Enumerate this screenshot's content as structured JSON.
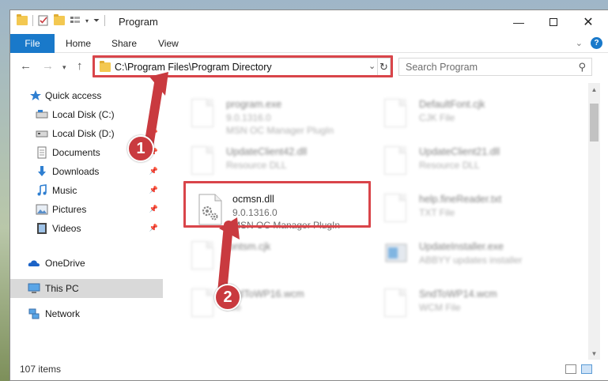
{
  "window": {
    "title": "Program"
  },
  "ribbon": {
    "tabs": [
      {
        "label": "File"
      },
      {
        "label": "Home"
      },
      {
        "label": "Share"
      },
      {
        "label": "View"
      }
    ]
  },
  "address": {
    "path": "C:\\Program Files\\Program Directory"
  },
  "search": {
    "placeholder": "Search Program"
  },
  "sidebar": {
    "items": [
      {
        "label": "Quick access",
        "icon": "star-icon"
      },
      {
        "label": "Local Disk (C:)",
        "icon": "drive-icon"
      },
      {
        "label": "Local Disk (D:)",
        "icon": "drive-icon"
      },
      {
        "label": "Documents",
        "icon": "documents-icon"
      },
      {
        "label": "Downloads",
        "icon": "download-icon"
      },
      {
        "label": "Music",
        "icon": "music-icon"
      },
      {
        "label": "Pictures",
        "icon": "pictures-icon"
      },
      {
        "label": "Videos",
        "icon": "videos-icon"
      },
      {
        "label": "OneDrive",
        "icon": "cloud-icon"
      },
      {
        "label": "This PC",
        "icon": "computer-icon"
      },
      {
        "label": "Network",
        "icon": "network-icon"
      }
    ]
  },
  "files": [
    {
      "name": "program.exe",
      "line2": "9.0.1316.0",
      "line3": "MSN OC Manager PlugIn"
    },
    {
      "name": "DefaultFont.cjk",
      "line2": "CJK File",
      "line3": ""
    },
    {
      "name": "UpdateClient42.dll",
      "line2": "Resource DLL",
      "line3": ""
    },
    {
      "name": "UpdateClient21.dll",
      "line2": "Resource DLL",
      "line3": ""
    },
    {
      "name": "ocmsn.dll",
      "line2": "9.0.1316.0",
      "line3": "MSN OC Manager PlugIn"
    },
    {
      "name": "help.fineReader.txt",
      "line2": "TXT File",
      "line3": ""
    },
    {
      "name": "fontsm.cjk",
      "line2": "",
      "line3": ""
    },
    {
      "name": "UpdateInstaller.exe",
      "line2": "ABBYY updates installer",
      "line3": ""
    },
    {
      "name": "SndToWP16.wcm",
      "line2": "File",
      "line3": ""
    },
    {
      "name": "SndToWP14.wcm",
      "line2": "WCM File",
      "line3": ""
    }
  ],
  "status": {
    "count": "107 items"
  },
  "callouts": {
    "one": "1",
    "two": "2"
  },
  "colors": {
    "accent": "#1979ca",
    "highlight": "#d9454a",
    "callout": "#c93a3f"
  }
}
